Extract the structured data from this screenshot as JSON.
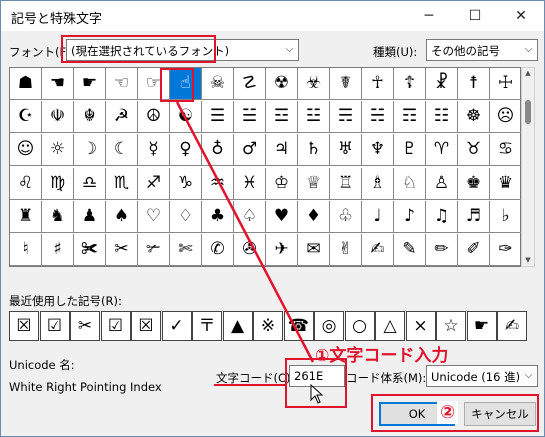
{
  "window": {
    "title": "記号と特殊文字",
    "minimize": "─",
    "maximize": "☐",
    "close": "✕"
  },
  "font": {
    "label": "フォント(F):",
    "value": "(現在選択されているフォント)"
  },
  "category": {
    "label": "種類(U):",
    "value": "その他の記号"
  },
  "symbols": [
    [
      "☗",
      "☚",
      "☛",
      "☜",
      "☞",
      "☝",
      "☠",
      "☡",
      "☢",
      "☣",
      "☤",
      "☥",
      "☦",
      "☧",
      "☨",
      "☩"
    ],
    [
      "☪",
      "☫",
      "☬",
      "☭",
      "☮",
      "☯",
      "☰",
      "☱",
      "☲",
      "☳",
      "☴",
      "☵",
      "☶",
      "☷",
      "☸",
      "☹"
    ],
    [
      "☺",
      "☼",
      "☽",
      "☾",
      "☿",
      "♀",
      "♁",
      "♂",
      "♃",
      "♄",
      "♅",
      "♆",
      "♇",
      "♈",
      "♉",
      "♋"
    ],
    [
      "♌",
      "♍",
      "♎",
      "♏",
      "♐",
      "♑",
      "♒",
      "♓",
      "♔",
      "♕",
      "♖",
      "♗",
      "♘",
      "♙",
      "♚",
      "♛"
    ],
    [
      "♜",
      "♞",
      "♟",
      "♠",
      "♡",
      "♢",
      "♣",
      "♤",
      "♥",
      "♦",
      "♧",
      "♩",
      "♪",
      "♫",
      "♬",
      "♭"
    ],
    [
      "♮",
      "♯",
      "✀",
      "✂",
      "✃",
      "✄",
      "✆",
      "✇",
      "✈",
      "✉",
      "✌",
      "✍",
      "✎",
      "✏",
      "✐",
      "✑"
    ]
  ],
  "selected_cell": {
    "row": 0,
    "col": 5
  },
  "recent": {
    "label": "最近使用した記号(R):",
    "items": [
      "☒",
      "☑",
      "✂",
      "☑",
      "☒",
      "✓",
      "〒",
      "▲",
      "※",
      "☎",
      "◎",
      "○",
      "△",
      "×",
      "☆",
      "☛",
      "✍"
    ]
  },
  "unicode": {
    "name_label": "Unicode 名:",
    "name_value": "White Right Pointing Index",
    "code_label": "文字コード(C):",
    "code_value": "261E",
    "system_label": "コード体系(M):",
    "system_value": "Unicode (16 進)"
  },
  "buttons": {
    "ok": "OK",
    "cancel": "キャンセル"
  },
  "annotations": {
    "step1": "①文字コード入力",
    "step2": "②"
  },
  "colors": {
    "accent": "#0078d7",
    "annotation_red": "#e0152d"
  }
}
